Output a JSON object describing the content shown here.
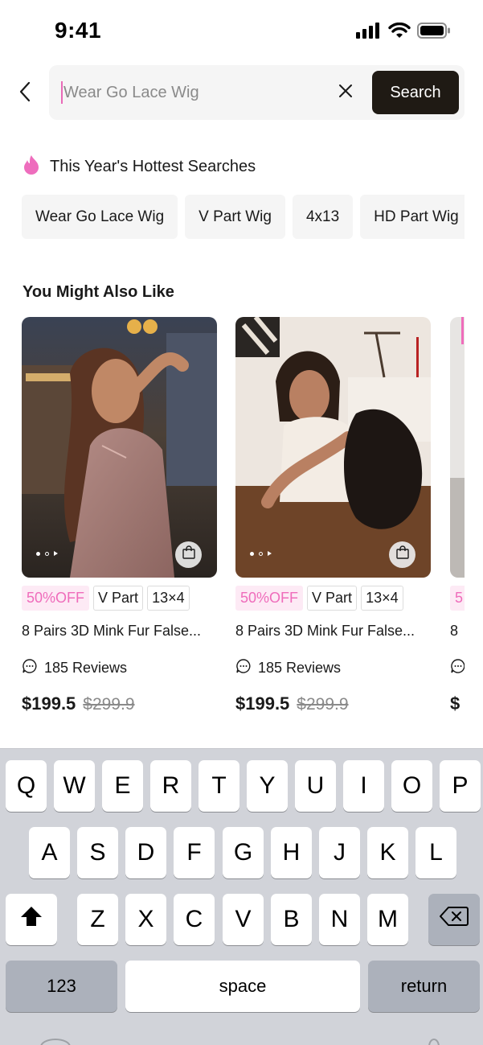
{
  "status_bar": {
    "time": "9:41"
  },
  "search": {
    "placeholder": "Wear Go Lace Wig",
    "button_label": "Search"
  },
  "hottest": {
    "title": "This Year's Hottest Searches",
    "chips": [
      "Wear Go Lace Wig",
      "V Part Wig",
      "4x13",
      "HD Part Wig"
    ]
  },
  "recommend": {
    "title": "You Might Also Like",
    "products": [
      {
        "discount": "50%OFF",
        "tag1": "V Part",
        "tag2": "13×4",
        "title": "8 Pairs 3D Mink Fur False...",
        "reviews": "185 Reviews",
        "price": "$199.5",
        "old_price": "$299.9"
      },
      {
        "discount": "50%OFF",
        "tag1": "V Part",
        "tag2": "13×4",
        "title": "8 Pairs 3D Mink Fur False...",
        "reviews": "185 Reviews",
        "price": "$199.5",
        "old_price": "$299.9"
      },
      {
        "discount": "5",
        "title": "8",
        "price": "$"
      }
    ]
  },
  "keyboard": {
    "row1": [
      "Q",
      "W",
      "E",
      "R",
      "T",
      "Y",
      "U",
      "I",
      "O",
      "P"
    ],
    "row2": [
      "A",
      "S",
      "D",
      "F",
      "G",
      "H",
      "J",
      "K",
      "L"
    ],
    "row3": [
      "Z",
      "X",
      "C",
      "V",
      "B",
      "N",
      "M"
    ],
    "numbers_key": "123",
    "space_key": "space",
    "return_key": "return"
  },
  "colors": {
    "accent_pink": "#ef6cbb",
    "search_button": "#1f1a14",
    "keyboard_bg": "#d1d3d9"
  },
  "icons": [
    "signal-icon",
    "wifi-icon",
    "battery-icon",
    "back-icon",
    "clear-icon",
    "fire-icon",
    "shopping-bag-icon",
    "chat-bubble-icon",
    "shift-icon",
    "backspace-icon"
  ]
}
